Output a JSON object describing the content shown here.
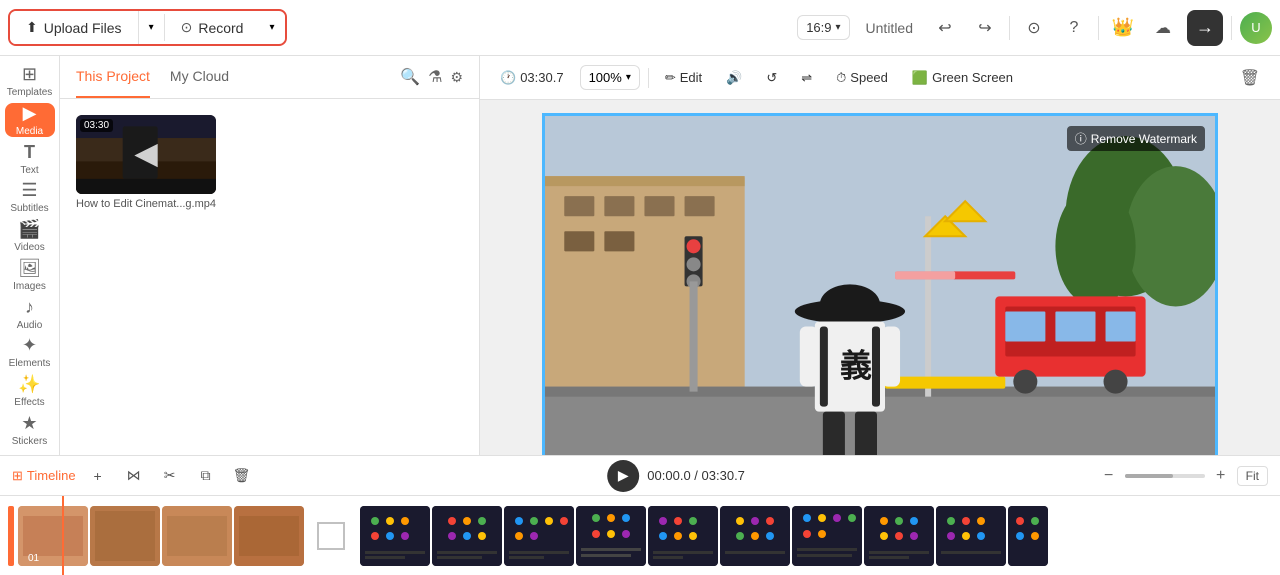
{
  "topBar": {
    "uploadLabel": "Upload Files",
    "recordLabel": "Record",
    "ratio": "16:9",
    "projectTitle": "Untitled",
    "exportArrow": "→"
  },
  "sidebar": {
    "items": [
      {
        "id": "templates",
        "label": "Templates",
        "icon": "⊞"
      },
      {
        "id": "media",
        "label": "Media",
        "icon": "▶",
        "active": true
      },
      {
        "id": "text",
        "label": "Text",
        "icon": "T"
      },
      {
        "id": "subtitles",
        "label": "Subtitles",
        "icon": "☰"
      },
      {
        "id": "videos",
        "label": "Videos",
        "icon": "🎬"
      },
      {
        "id": "images",
        "label": "Images",
        "icon": "🖼"
      },
      {
        "id": "audio",
        "label": "Audio",
        "icon": "♪"
      },
      {
        "id": "elements",
        "label": "Elements",
        "icon": "✦"
      },
      {
        "id": "effects",
        "label": "Effects",
        "icon": "✨"
      },
      {
        "id": "stickers",
        "label": "Stickers",
        "icon": "★"
      }
    ]
  },
  "mediaPanel": {
    "tabs": [
      {
        "id": "project",
        "label": "This Project",
        "active": true
      },
      {
        "id": "cloud",
        "label": "My Cloud"
      }
    ],
    "items": [
      {
        "id": "item1",
        "duration": "03:30",
        "label": "How to Edit Cinemat...g.mp4"
      }
    ]
  },
  "previewToolbar": {
    "time": "03:30.7",
    "zoom": "100%",
    "editLabel": "Edit",
    "speedLabel": "Speed",
    "greenScreenLabel": "Green Screen"
  },
  "watermark": {
    "label": "Remove Watermark",
    "icon": "ⓘ"
  },
  "timeline": {
    "label": "Timeline",
    "playTime": "00:00.0",
    "totalTime": "03:30.7",
    "fitLabel": "Fit"
  }
}
